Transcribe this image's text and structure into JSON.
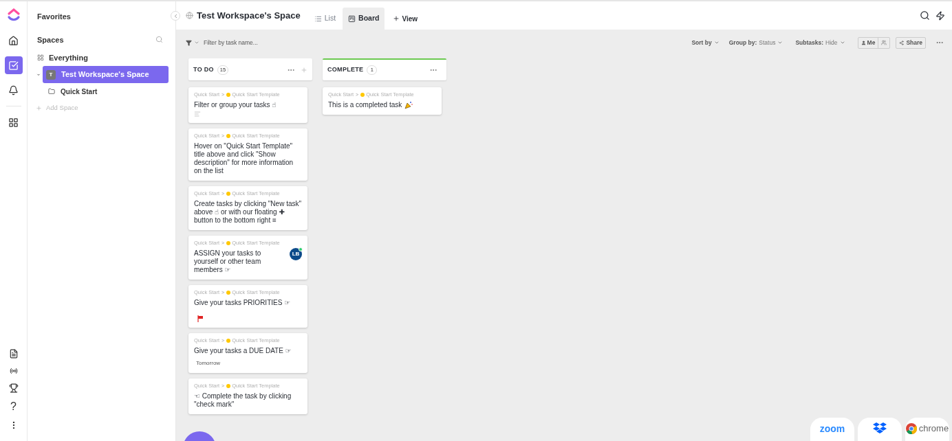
{
  "rail": {
    "top": [
      {
        "selected": false
      },
      {
        "selected": true
      },
      {
        "selected": false
      },
      {
        "selected": false
      }
    ],
    "help_label": "?"
  },
  "sidebar": {
    "favorites": "Favorites",
    "spaces": "Spaces",
    "items": [
      {
        "kind": "everything",
        "label": "Everything",
        "selected": false
      },
      {
        "kind": "space",
        "label": "Test Workspace's Space",
        "avatar": "T",
        "selected": true,
        "expanded": true,
        "children": [
          {
            "kind": "folder",
            "label": "Quick Start",
            "selected": false
          }
        ]
      }
    ],
    "add_space": "Add Space"
  },
  "header": {
    "title": "Test Workspace's Space",
    "tabs": [
      {
        "label": "List",
        "selected": false
      },
      {
        "label": "Board",
        "selected": true
      }
    ],
    "add_view": "View"
  },
  "toolbar": {
    "filter_placeholder": "Filter by task name...",
    "sort": "Sort by",
    "group_label": "Group by:",
    "group_value": "Status",
    "subtasks_label": "Subtasks:",
    "subtasks_value": "Hide",
    "me": "Me",
    "share": "Share"
  },
  "columns": [
    {
      "name": "TO DO",
      "count": "15",
      "can_add": true,
      "cards": [
        {
          "kind": "task",
          "path": "Quick Start",
          "sep": ">",
          "list": "Quick Start Template",
          "title": "Filter or group your tasks ☝",
          "footer": [
            {
              "kind": "description"
            }
          ]
        },
        {
          "kind": "task",
          "path": "Quick Start",
          "sep": ">",
          "list": "Quick Start Template",
          "title": "Hover on \"Quick Start Template\" title above and click \"Show description\" for more information on the list"
        },
        {
          "kind": "task",
          "path": "Quick Start",
          "sep": ">",
          "list": "Quick Start Template",
          "title": "Create tasks by clicking \"New task\" above ☝ or with our floating ✚ button to the bottom right ≡"
        },
        {
          "kind": "task",
          "path": "Quick Start",
          "sep": ">",
          "list": "Quick Start Template",
          "title": "ASSIGN your tasks to yourself or other team members ☞",
          "assignee": "LB"
        },
        {
          "kind": "task",
          "path": "Quick Start",
          "sep": ">",
          "list": "Quick Start Template",
          "title": "Give your tasks PRIORITIES ☞",
          "footer": [
            {
              "kind": "flag",
              "color": "#e02424"
            }
          ]
        },
        {
          "kind": "task",
          "path": "Quick Start",
          "sep": ">",
          "list": "Quick Start Template",
          "title": "Give your tasks a DUE DATE ☞",
          "footer": [
            {
              "kind": "due",
              "text": "Tomorrow"
            }
          ]
        },
        {
          "kind": "task",
          "path": "Quick Start",
          "sep": ">",
          "list": "Quick Start Template",
          "title": "☜ Complete the task by clicking \"check mark\""
        }
      ]
    },
    {
      "name": "COMPLETE",
      "count": "1",
      "color": "#6bc950",
      "can_add": false,
      "cards": [
        {
          "kind": "celebrate",
          "path": "Quick Start",
          "sep": ">",
          "list": "Quick Start Template",
          "title": "This is a completed task"
        }
      ]
    }
  ],
  "integrations": [
    {
      "kind": "zoom",
      "label": "zoom"
    },
    {
      "kind": "dropbox"
    },
    {
      "kind": "chrome",
      "label": "chrome"
    }
  ]
}
